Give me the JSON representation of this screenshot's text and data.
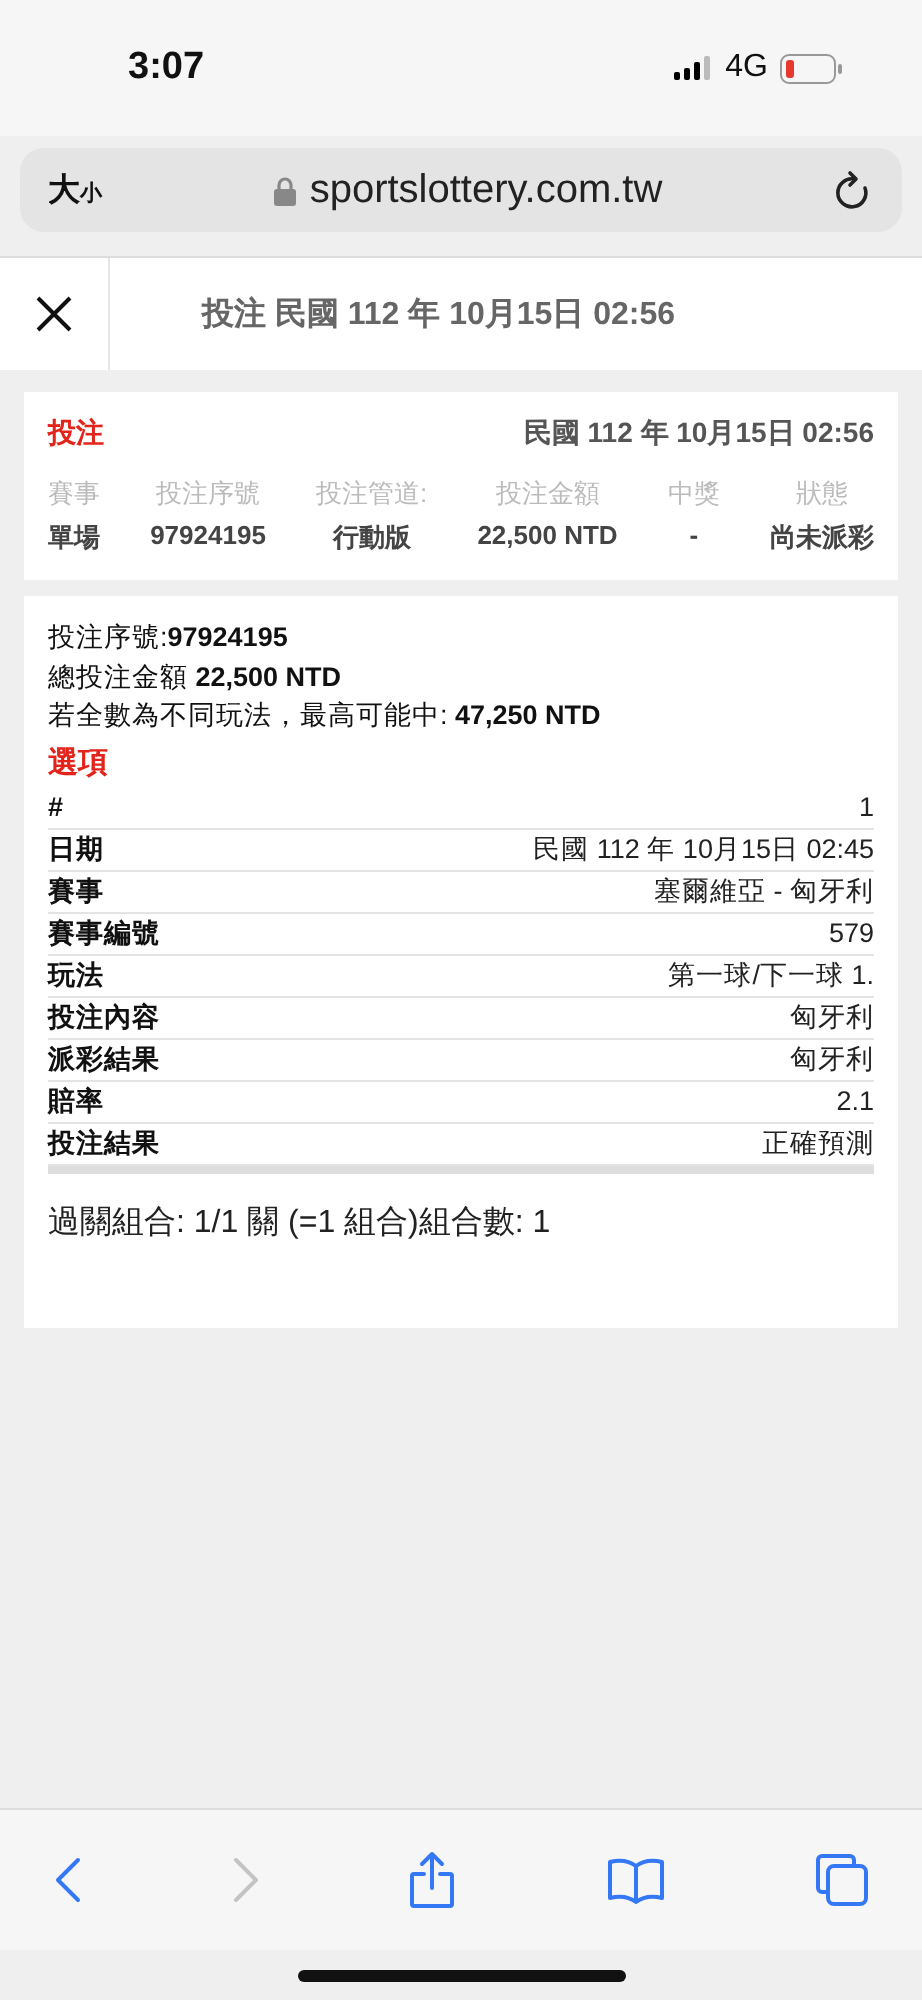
{
  "status_bar": {
    "time": "3:07",
    "network": "4G"
  },
  "browser": {
    "text_size_large": "大",
    "text_size_small": "小",
    "url": "sportslottery.com.tw"
  },
  "header": {
    "title": "投注 民國 112 年 10月15日 02:56"
  },
  "summary": {
    "label": "投注",
    "date": "民國 112 年 10月15日 02:56",
    "columns": [
      {
        "heading": "賽事",
        "value": "單場"
      },
      {
        "heading": "投注序號",
        "value": "97924195"
      },
      {
        "heading": "投注管道:",
        "value": "行動版"
      },
      {
        "heading": "投注金額",
        "value": "22,500 NTD"
      },
      {
        "heading": "中獎",
        "value": "-"
      },
      {
        "heading": "狀態",
        "value": "尚未派彩"
      }
    ]
  },
  "details": {
    "lines": [
      "投注序號:**97924195**",
      "總投注金額 **22,500 NTD**",
      "若全數為不同玩法，最高可能中: **47,250 NTD**"
    ],
    "section_title": "選項",
    "rows": [
      {
        "label": "#",
        "value": "1"
      },
      {
        "label": "日期",
        "value": "民國 112 年 10月15日 02:45"
      },
      {
        "label": "賽事",
        "value": "塞爾維亞 - 匈牙利"
      },
      {
        "label": "賽事編號",
        "value": "579"
      },
      {
        "label": "玩法",
        "value": "第一球/下一球 1."
      },
      {
        "label": "投注內容",
        "value": "匈牙利"
      },
      {
        "label": "派彩結果",
        "value": "匈牙利"
      },
      {
        "label": "賠率",
        "value": "2.1"
      },
      {
        "label": "投注結果",
        "value": "正確預測"
      }
    ],
    "combination": "過關組合: 1/1 關 (=1 組合)組合數: 1"
  },
  "toolbar": [
    {
      "kind": "back",
      "disabled": false
    },
    {
      "kind": "forward",
      "disabled": true
    },
    {
      "kind": "share",
      "disabled": false
    },
    {
      "kind": "bookmarks",
      "disabled": false
    },
    {
      "kind": "tabs",
      "disabled": false
    }
  ]
}
